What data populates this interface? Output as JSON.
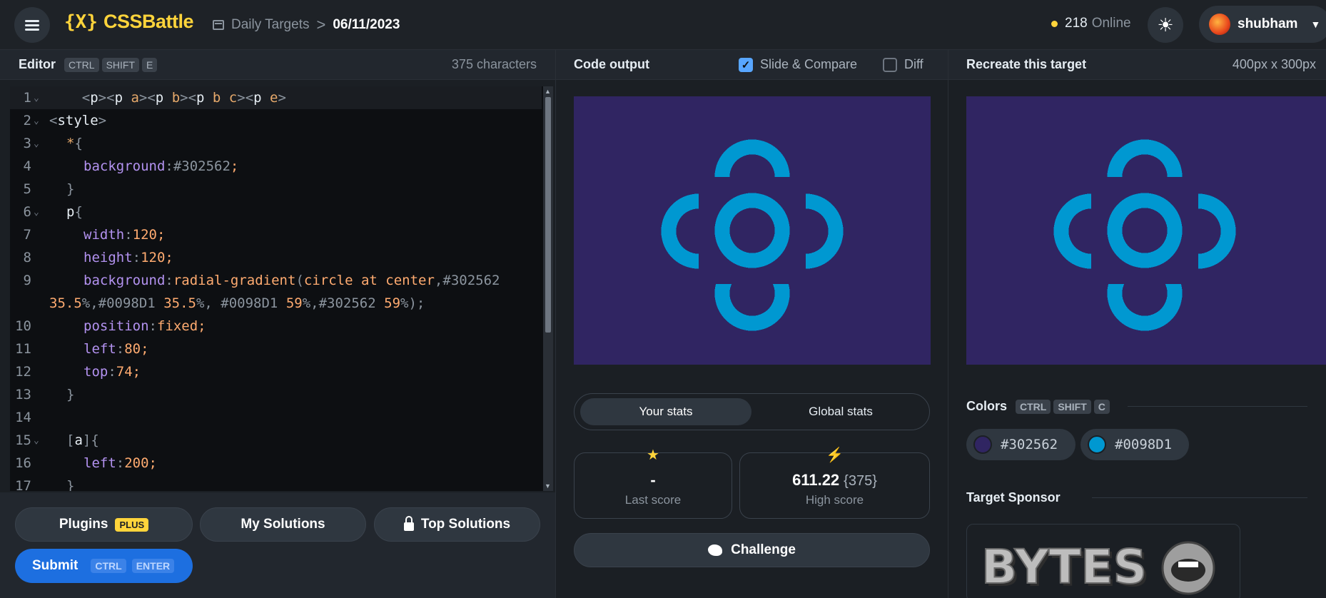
{
  "app": {
    "logo_mark": "{X}",
    "logo_text": "CSSBattle"
  },
  "breadcrumb": {
    "section": "Daily Targets",
    "separator": ">",
    "date": "06/11/2023"
  },
  "header": {
    "online_count": "218",
    "online_label": "Online",
    "user_name": "shubham"
  },
  "editor": {
    "title": "Editor",
    "shortcut": [
      "CTRL",
      "SHIFT",
      "E"
    ],
    "char_count": "375 characters",
    "lines": [
      {
        "n": "1",
        "fold": true
      },
      {
        "n": "2",
        "fold": true
      },
      {
        "n": "3",
        "fold": true
      },
      {
        "n": "4",
        "fold": false
      },
      {
        "n": "5",
        "fold": false
      },
      {
        "n": "6",
        "fold": true
      },
      {
        "n": "7",
        "fold": false
      },
      {
        "n": "8",
        "fold": false
      },
      {
        "n": "9",
        "fold": false
      },
      {
        "n": "",
        "fold": false
      },
      {
        "n": "10",
        "fold": false
      },
      {
        "n": "11",
        "fold": false
      },
      {
        "n": "12",
        "fold": false
      },
      {
        "n": "13",
        "fold": false
      },
      {
        "n": "14",
        "fold": false
      },
      {
        "n": "15",
        "fold": true
      },
      {
        "n": "16",
        "fold": false
      },
      {
        "n": "17",
        "fold": false
      }
    ],
    "code": {
      "l1": [
        "<",
        "p",
        "><",
        "p",
        " a",
        "><",
        "p",
        " b",
        "><",
        "p",
        " b c",
        "><",
        "p",
        " e",
        ">"
      ],
      "l2": [
        "<",
        "style",
        ">"
      ],
      "l3": [
        "*",
        "{"
      ],
      "l4": [
        "background",
        ":",
        "#302562",
        ";"
      ],
      "l5": [
        "}"
      ],
      "l6": [
        "p",
        "{"
      ],
      "l7": [
        "width",
        ":",
        "120",
        ";"
      ],
      "l8": [
        "height",
        ":",
        "120",
        ";"
      ],
      "l9": [
        "background",
        ":",
        "radial-gradient",
        "(",
        "circle at center",
        ",",
        "#302562"
      ],
      "l9b": [
        "35.5",
        "%",
        ",",
        "#0098D1",
        " 35.5",
        "%",
        ", ",
        "#0098D1",
        " 59",
        "%",
        ",",
        "#302562",
        " 59",
        "%",
        ");"
      ],
      "l10": [
        "position",
        ":",
        "fixed",
        ";"
      ],
      "l11": [
        "left",
        ":",
        "80",
        ";"
      ],
      "l12": [
        "top",
        ":",
        "74",
        ";"
      ],
      "l13": [
        "}"
      ],
      "l15": [
        "[",
        "a",
        "]",
        "{"
      ],
      "l16": [
        "left",
        ":",
        "200",
        ";"
      ],
      "l17": [
        "}"
      ]
    }
  },
  "buttons": {
    "plugins": "Plugins",
    "plus_badge": "PLUS",
    "my_solutions": "My Solutions",
    "top_solutions": "Top Solutions",
    "submit": "Submit",
    "submit_keys": [
      "CTRL",
      "ENTER"
    ]
  },
  "output": {
    "title": "Code output",
    "slide_compare": "Slide & Compare",
    "slide_compare_checked": true,
    "diff": "Diff",
    "diff_checked": false
  },
  "target": {
    "title": "Recreate this target",
    "dimensions": "400px x 300px"
  },
  "stats": {
    "tab_yours": "Your stats",
    "tab_global": "Global stats",
    "last_score_value": "-",
    "last_score_label": "Last score",
    "high_score_value": "611.22",
    "high_score_chars": "{375}",
    "high_score_label": "High score",
    "challenge": "Challenge"
  },
  "colors": {
    "title": "Colors",
    "shortcut": [
      "CTRL",
      "SHIFT",
      "C"
    ],
    "swatches": [
      {
        "hex": "#302562",
        "label": "#302562"
      },
      {
        "hex": "#0098D1",
        "label": "#0098D1"
      }
    ]
  },
  "sponsor": {
    "title": "Target Sponsor",
    "logo_text": "BYTES"
  },
  "palette": {
    "accent_yellow": "#ffd43b",
    "submit_blue": "#1d6fe0",
    "bg": "#1b1f24"
  }
}
